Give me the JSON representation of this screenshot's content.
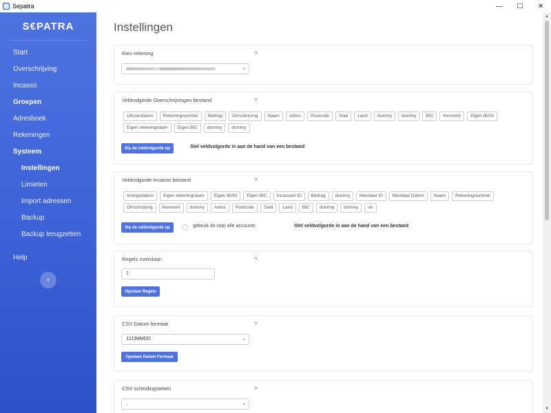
{
  "window": {
    "title": "Sepatra",
    "controls": {
      "minimize": "—",
      "maximize": "☐",
      "close": "✕"
    }
  },
  "sidebar": {
    "brand": "S€PATRA",
    "items": [
      {
        "label": "Start",
        "bold": false
      },
      {
        "label": "Overschrijving",
        "bold": false
      },
      {
        "label": "Incasso",
        "bold": false
      },
      {
        "label": "Groepen",
        "bold": true
      },
      {
        "label": "Adresboek",
        "bold": false
      },
      {
        "label": "Rekeningen",
        "bold": false
      },
      {
        "label": "Systeem",
        "bold": true
      }
    ],
    "subitems": [
      {
        "label": "Instellingen",
        "active": true
      },
      {
        "label": "Limieten",
        "active": false
      },
      {
        "label": "Import adressen",
        "active": false
      },
      {
        "label": "Backup",
        "active": false
      },
      {
        "label": "Backup terugzetten",
        "active": false
      }
    ],
    "help": "Help",
    "collapse_icon": "‹"
  },
  "main": {
    "title": "Instellingen",
    "help_mark": "?",
    "account": {
      "label": "Kies rekening"
    },
    "order_transfers": {
      "label": "Veldvolgorde Overschrijvingen bestand",
      "fields": [
        "Uitvoerdatum",
        "Rekeningnummer",
        "Bedrag",
        "Omschrijving",
        "Naam",
        "Adres",
        "Postcode",
        "Stad",
        "Land",
        "dummy",
        "dummy",
        "BIC",
        "Kenmerk",
        "Eigen IBAN",
        "Eigen rekeningnaam",
        "Eigen BIC",
        "dummy",
        "dummy"
      ],
      "save_button": "Sla de veldvolgorde op",
      "note": "Stel veldvolgorde in aan de hand van een bestand"
    },
    "order_debit": {
      "label": "Veldvolgorde Incasso bestand",
      "fields": [
        "Inningsdatum",
        "Eigen rekeningnaam",
        "Eigen IBAN",
        "Eigen BIC",
        "Incassant ID",
        "Bedrag",
        "dummy",
        "Mandaat ID",
        "Mandaat Datum",
        "Naam",
        "Rekeningnummer",
        "Omschrijving",
        "Kenmerk",
        "dummy",
        "Adres",
        "Postcode",
        "Stad",
        "Land",
        "BIC",
        "dummy",
        "dummy",
        "on"
      ],
      "save_button": "Sla de veldvolgorde op",
      "checkbox_label": "gebruik dit voor alle accounts",
      "note": "Stel veldvolgorde in aan de hand van een bestand"
    },
    "skip_rows": {
      "label": "Regels overslaan",
      "value": "1",
      "save_button": "Opslaan Regels"
    },
    "date_format": {
      "label": "CSV Datum formaat",
      "value": "JJJJMMDD",
      "save_button": "Opslaan Datum Formaat"
    },
    "separator": {
      "label": "CSV scheidingsteken",
      "value": ","
    }
  }
}
